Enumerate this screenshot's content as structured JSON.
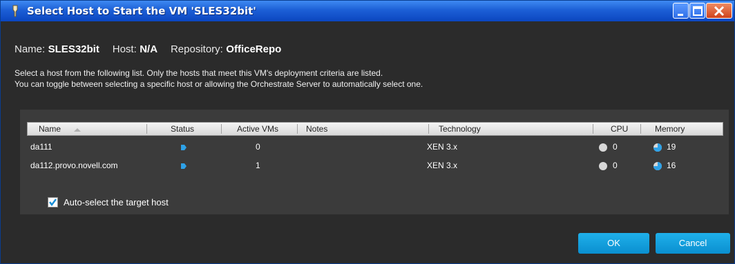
{
  "window": {
    "title": "Select Host to Start the VM 'SLES32bit'"
  },
  "info": {
    "name_label": "Name:",
    "name_value": "SLES32bit",
    "host_label": "Host:",
    "host_value": "N/A",
    "repo_label": "Repository:",
    "repo_value": "OfficeRepo"
  },
  "instructions": {
    "line1": "Select a host from the following list. Only the hosts that meet this VM's deployment criteria are listed.",
    "line2": "You can toggle between selecting a specific host or allowing the Orchestrate Server to automatically select one."
  },
  "table": {
    "columns": [
      "Name",
      "Status",
      "Active VMs",
      "Notes",
      "Technology",
      "CPU",
      "Memory"
    ],
    "rows": [
      {
        "name": "da111",
        "active_vms": "0",
        "notes": "",
        "technology": "XEN 3.x",
        "cpu": "0",
        "memory": "19"
      },
      {
        "name": "da112.provo.novell.com",
        "active_vms": "1",
        "notes": "",
        "technology": "XEN 3.x",
        "cpu": "0",
        "memory": "16"
      }
    ]
  },
  "auto_select": {
    "label": "Auto-select the target host",
    "checked": true
  },
  "buttons": {
    "ok": "OK",
    "cancel": "Cancel"
  },
  "colors": {
    "accent": "#1aa8e6",
    "titlebar": "#1c5fd6",
    "panel": "#3b3b3b"
  }
}
